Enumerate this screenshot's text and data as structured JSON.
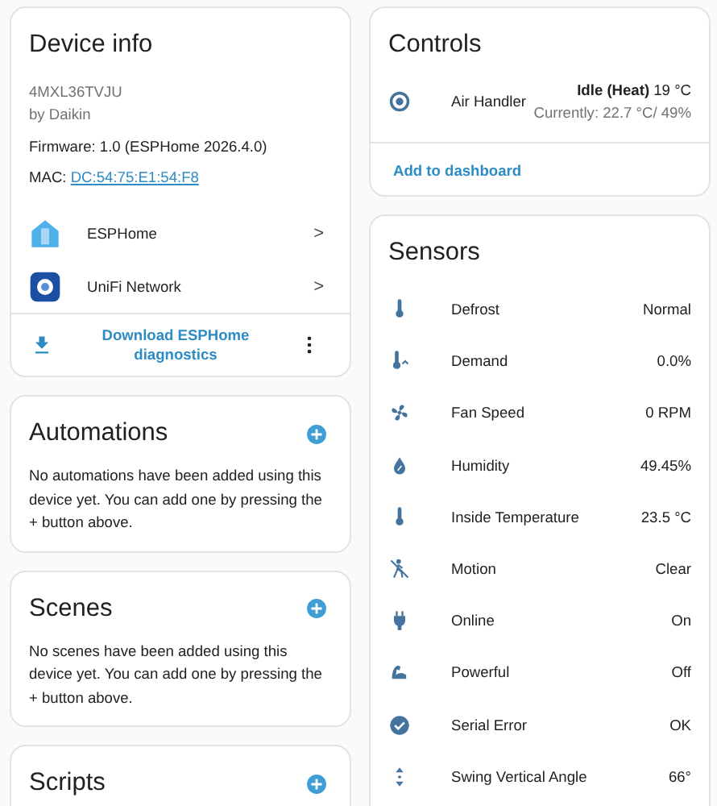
{
  "device_info": {
    "title": "Device info",
    "model": "4MXL36TVJU",
    "manufacturer": "by Daikin",
    "firmware": "Firmware: 1.0 (ESPHome 2026.4.0)",
    "mac_label": "MAC:",
    "mac": "DC:54:75:E1:54:F8",
    "integrations": [
      {
        "name": "ESPHome",
        "chevron": ">"
      },
      {
        "name": "UniFi Network",
        "chevron": ">"
      }
    ],
    "action": "Download ESPHome diagnostics"
  },
  "sections": [
    {
      "title": "Automations",
      "text": "No automations have been added using this device yet. You can add one by pressing the + button above."
    },
    {
      "title": "Scenes",
      "text": "No scenes have been added using this device yet. You can add one by pressing the + button above."
    },
    {
      "title": "Scripts"
    }
  ],
  "controls": {
    "title": "Controls",
    "entity": {
      "name": "Air Handler",
      "state": "Idle (Heat)",
      "target": "19 °C",
      "current": "Currently: 22.7 °C/ 49%"
    },
    "action": "Add to dashboard"
  },
  "sensors": {
    "title": "Sensors",
    "rows": [
      {
        "name": "Defrost",
        "value": "Normal"
      },
      {
        "name": "Demand",
        "value": "0.0%"
      },
      {
        "name": "Fan Speed",
        "value": "0 RPM"
      },
      {
        "name": "Humidity",
        "value": "49.45%"
      },
      {
        "name": "Inside Temperature",
        "value": "23.5 °C"
      },
      {
        "name": "Motion",
        "value": "Clear"
      },
      {
        "name": "Online",
        "value": "On"
      },
      {
        "name": "Powerful",
        "value": "Off"
      },
      {
        "name": "Serial Error",
        "value": "OK"
      },
      {
        "name": "Swing Vertical Angle",
        "value": "66°"
      }
    ]
  }
}
